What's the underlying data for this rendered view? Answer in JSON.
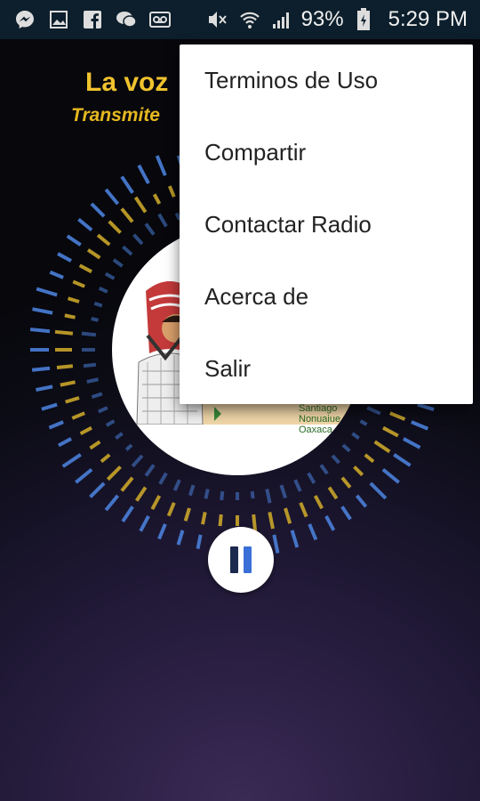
{
  "status_bar": {
    "icons": [
      "messenger-icon",
      "gallery-icon",
      "facebook-icon",
      "chat-icon",
      "voicemail-icon",
      "mute-icon",
      "wifi-icon",
      "signal-icon"
    ],
    "battery": "93%",
    "time": "5:29 PM"
  },
  "header": {
    "title": "La voz",
    "subtitle": "Transmite"
  },
  "album": {
    "caption": "Santiago Nonuaiue, Oaxaca"
  },
  "player": {
    "state": "playing",
    "button_icon": "pause-icon"
  },
  "menu": {
    "items": [
      {
        "label": "Terminos de Uso"
      },
      {
        "label": "Compartir"
      },
      {
        "label": "Contactar Radio"
      },
      {
        "label": "Acerca de"
      },
      {
        "label": "Salir"
      }
    ]
  },
  "colors": {
    "status_bar_bg": "#0d1f2c",
    "title": "#f0c22e",
    "ring_blue": "#4a7fd8",
    "ring_yellow": "#c9a52a"
  }
}
